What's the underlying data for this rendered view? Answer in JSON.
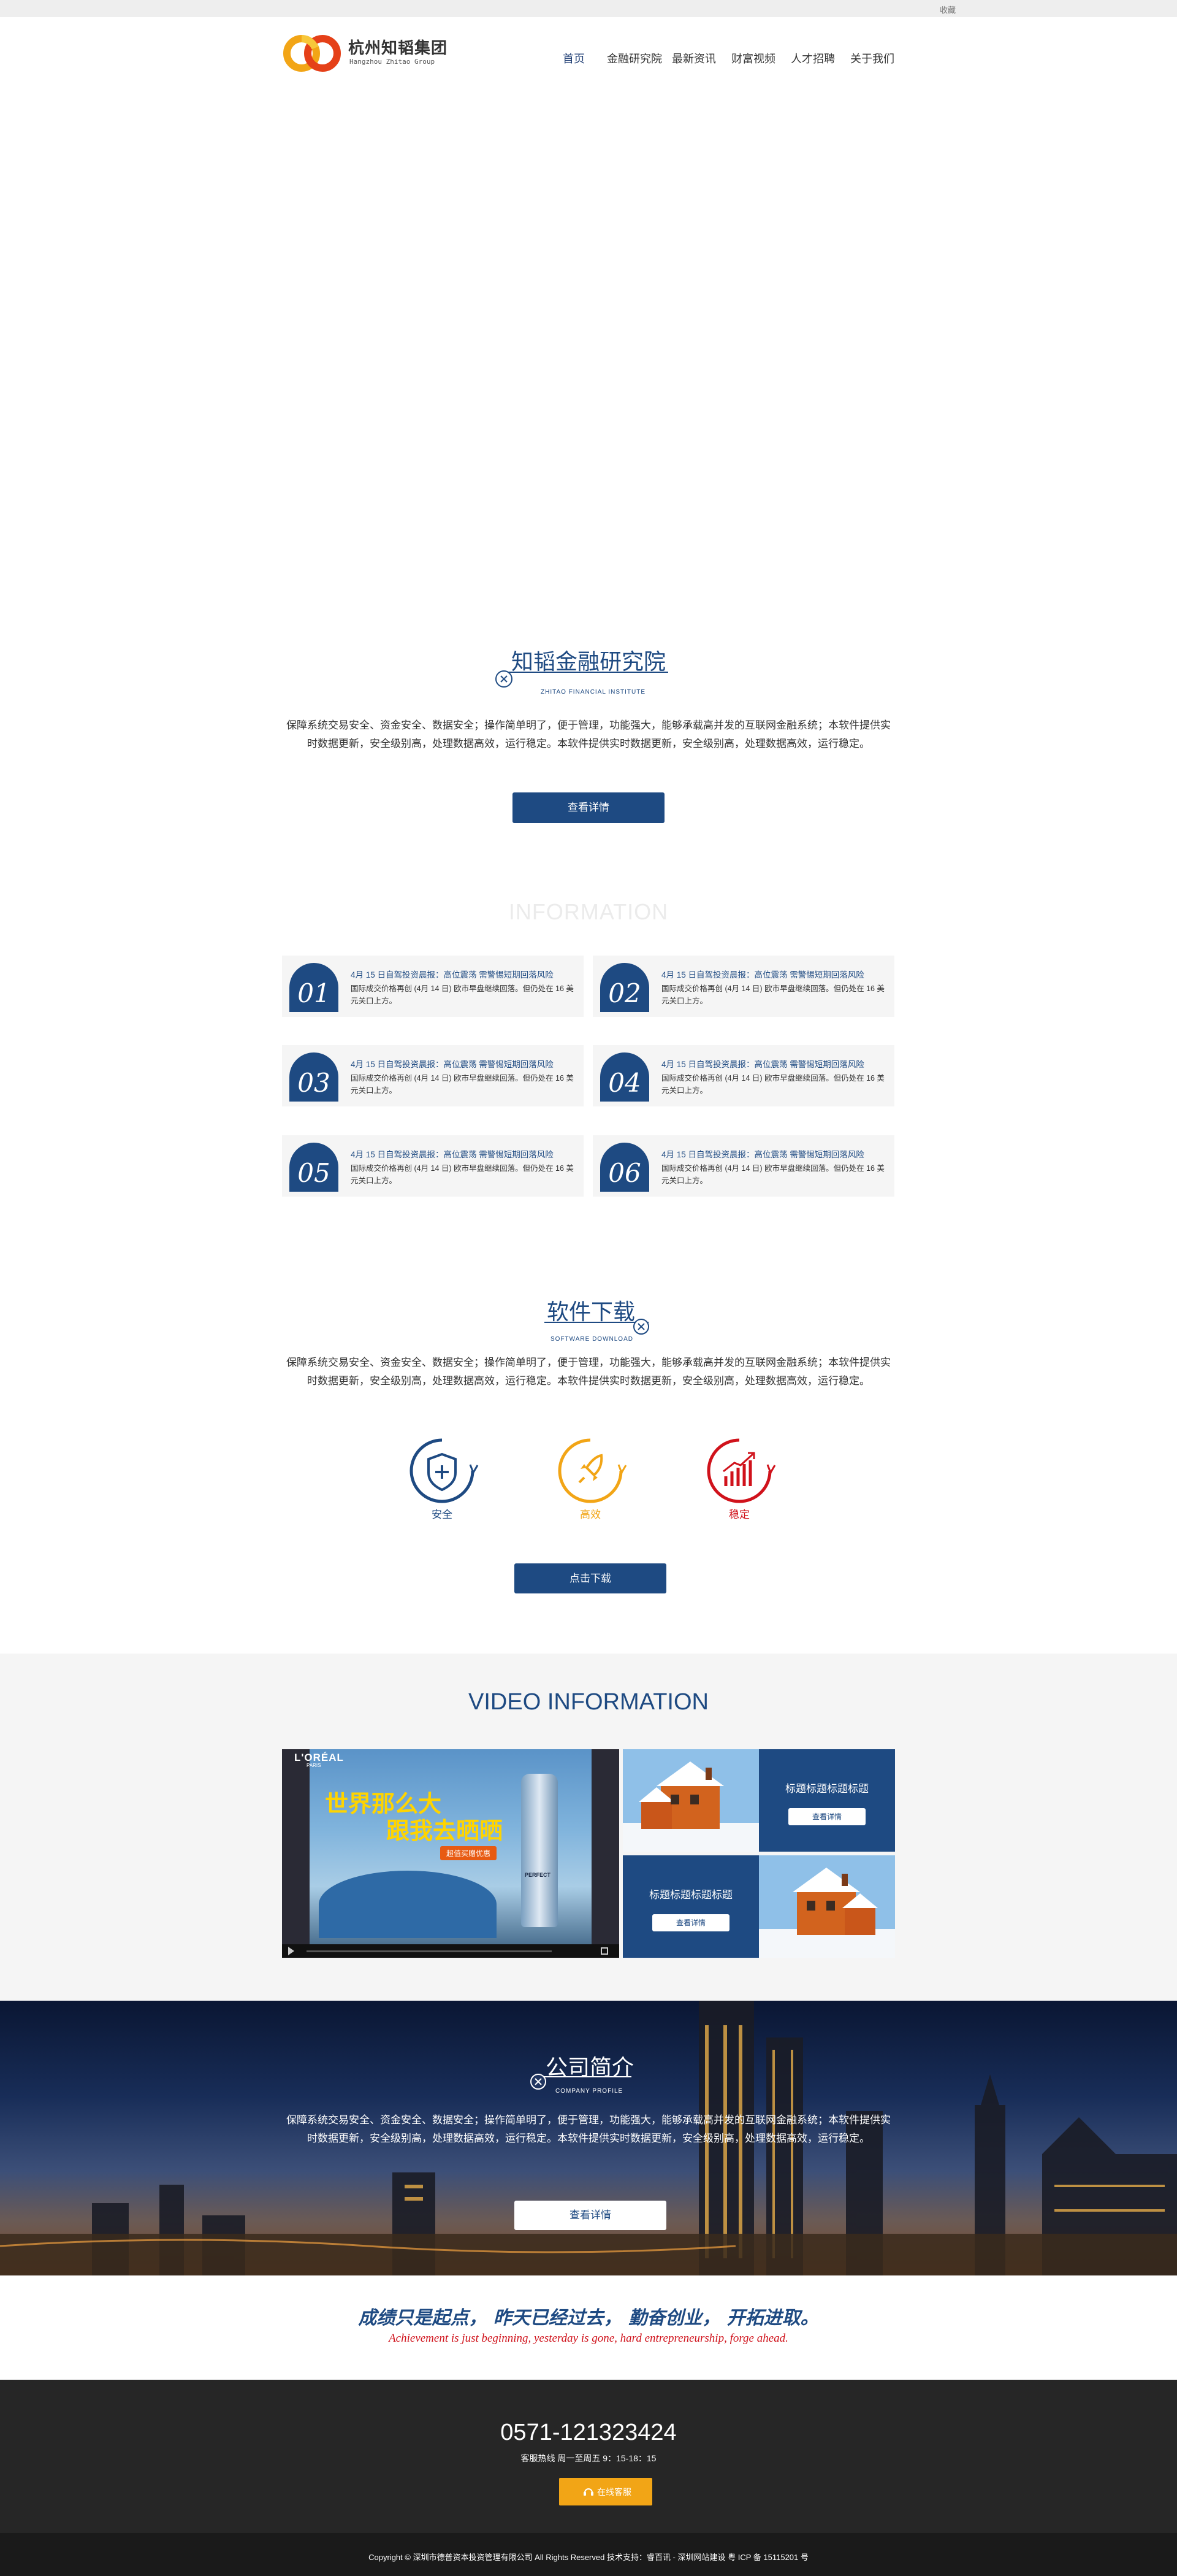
{
  "topbar": {
    "favorite_label": "收藏"
  },
  "header": {
    "logo_cn": "杭州知韬集团",
    "logo_en": "Hangzhou Zhitao Group",
    "nav": [
      {
        "label": "首页",
        "active": true
      },
      {
        "label": "金融研究院",
        "active": false
      },
      {
        "label": "最新资讯",
        "active": false
      },
      {
        "label": "财富视频",
        "active": false
      },
      {
        "label": "人才招聘",
        "active": false
      },
      {
        "label": "关于我们",
        "active": false
      }
    ]
  },
  "institute": {
    "title": "知韬金融研究院",
    "subtitle": "ZHITAO FINANCIAL INSTITUTE",
    "paragraph": "保障系统交易安全、资金安全、数据安全；操作简单明了，便于管理，功能强大，能够承载高并发的互联网金融系统；本软件提供实时数据更新，安全级别高，处理数据高效，运行稳定。本软件提供实时数据更新，安全级别高，处理数据高效，运行稳定。",
    "button": "查看详情"
  },
  "information": {
    "title": "INFORMATION",
    "items": [
      {
        "num": "01",
        "headline": "4月 15 日自驾投资晨报：高位震荡 需警惕短期回落风险",
        "body": "国际成交价格再创 (4月 14 日) 欧市早盘继续回落。但仍处在 16 美元关口上方。"
      },
      {
        "num": "02",
        "headline": "4月 15 日自驾投资晨报：高位震荡 需警惕短期回落风险",
        "body": "国际成交价格再创 (4月 14 日) 欧市早盘继续回落。但仍处在 16 美元关口上方。"
      },
      {
        "num": "03",
        "headline": "4月 15 日自驾投资晨报：高位震荡 需警惕短期回落风险",
        "body": "国际成交价格再创 (4月 14 日) 欧市早盘继续回落。但仍处在 16 美元关口上方。"
      },
      {
        "num": "04",
        "headline": "4月 15 日自驾投资晨报：高位震荡 需警惕短期回落风险",
        "body": "国际成交价格再创 (4月 14 日) 欧市早盘继续回落。但仍处在 16 美元关口上方。"
      },
      {
        "num": "05",
        "headline": "4月 15 日自驾投资晨报：高位震荡 需警惕短期回落风险",
        "body": "国际成交价格再创 (4月 14 日) 欧市早盘继续回落。但仍处在 16 美元关口上方。"
      },
      {
        "num": "06",
        "headline": "4月 15 日自驾投资晨报：高位震荡 需警惕短期回落风险",
        "body": "国际成交价格再创 (4月 14 日) 欧市早盘继续回落。但仍处在 16 美元关口上方。"
      }
    ]
  },
  "software": {
    "title": "软件下载",
    "subtitle": "SOFTWARE DOWNLOAD",
    "paragraph": "保障系统交易安全、资金安全、数据安全；操作简单明了，便于管理，功能强大，能够承载高并发的互联网金融系统；本软件提供实时数据更新，安全级别高，处理数据高效，运行稳定。本软件提供实时数据更新，安全级别高，处理数据高效，运行稳定。",
    "features": [
      {
        "label": "安全",
        "icon": "shield-plus-icon",
        "color": "#1e4a82"
      },
      {
        "label": "高效",
        "icon": "rocket-icon",
        "color": "#f2a516"
      },
      {
        "label": "稳定",
        "icon": "bar-chart-icon",
        "color": "#d0121b"
      }
    ],
    "button": "点击下载"
  },
  "video": {
    "title": "VIDEO INFORMATION",
    "ad_brand": "L'ORÉAL",
    "ad_brand_sub": "PARIS",
    "ad_line1": "世界那么大",
    "ad_line2": "跟我去晒晒",
    "ad_badge": "超值买赠优惠",
    "ad_product": "PERFECT",
    "tiles": [
      {
        "title": "标题标题标题标题",
        "button": "查看详情"
      },
      {
        "title": "标题标题标题标题",
        "button": "查看详情"
      }
    ]
  },
  "about": {
    "title": "公司简介",
    "subtitle": "COMPANY PROFILE",
    "paragraph": "保障系统交易安全、资金安全、数据安全；操作简单明了，便于管理，功能强大，能够承载高并发的互联网金融系统；本软件提供实时数据更新，安全级别高，处理数据高效，运行稳定。本软件提供实时数据更新，安全级别高，处理数据高效，运行稳定。",
    "button": "查看详情"
  },
  "slogan": {
    "cn": "成绩只是起点， 昨天已经过去， 勤奋创业， 开拓进取。",
    "en": "Achievement is just beginning, yesterday is gone, hard entrepreneurship, forge ahead."
  },
  "footer": {
    "phone": "0571-121323424",
    "hours": "客服热线 周一至周五 9：15-18：15",
    "service_button": "在线客服",
    "copyright": "Copyright © 深圳市德普资本投资管理有限公司 All Rights Reserved  技术支持：睿百讯 - 深圳网站建设 粤 ICP 备 15115201 号"
  },
  "colors": {
    "navy": "#1e4a82",
    "orange": "#f2a516",
    "red": "#d0121b",
    "footer_bg": "#262626"
  }
}
